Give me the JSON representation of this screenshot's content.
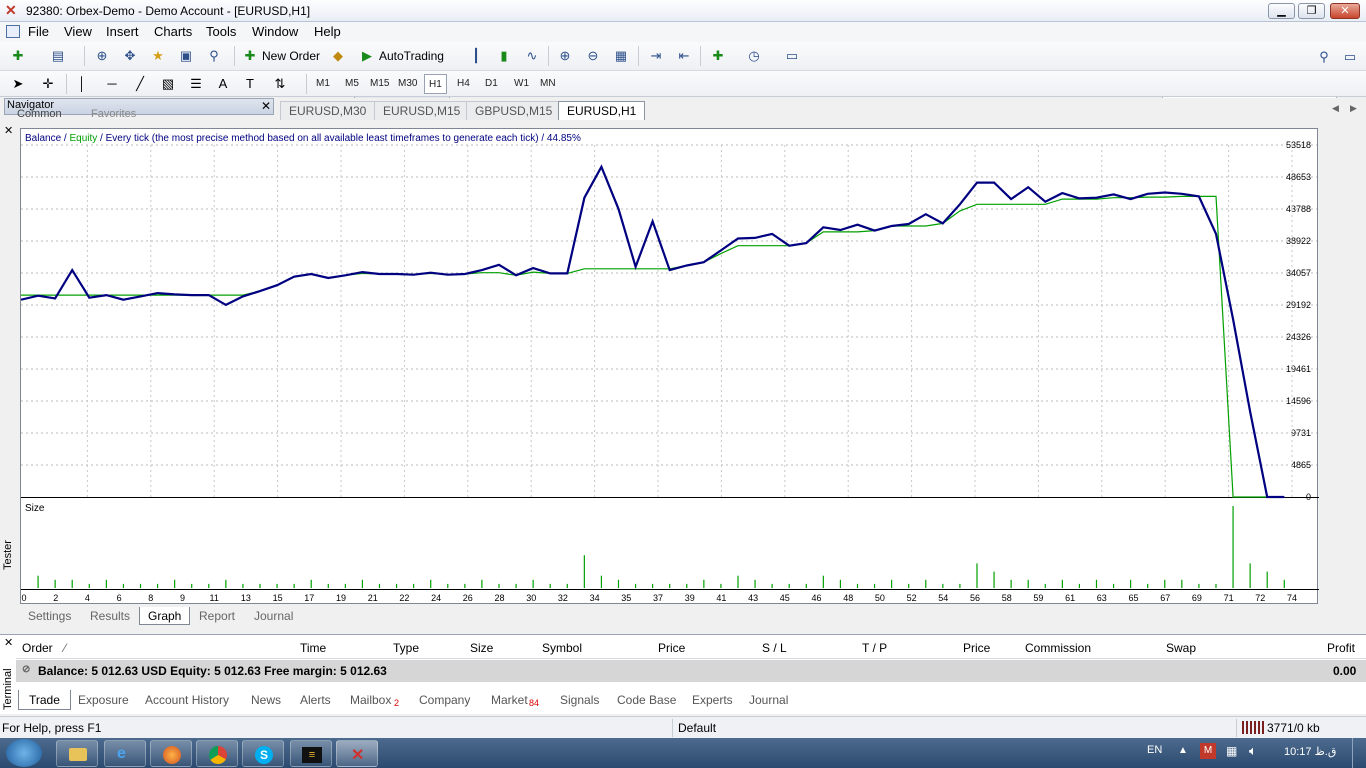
{
  "window": {
    "title": "92380: Orbex-Demo - Demo Account - [EURUSD,H1]"
  },
  "menu": [
    "File",
    "View",
    "Insert",
    "Charts",
    "Tools",
    "Window",
    "Help"
  ],
  "toolbar": {
    "new_order": "New Order",
    "autotrading": "AutoTrading"
  },
  "timeframes": [
    "M1",
    "M5",
    "M15",
    "M30",
    "H1",
    "H4",
    "D1",
    "W1",
    "MN"
  ],
  "active_timeframe": "H1",
  "navigator": {
    "title": "Navigator",
    "tabs": [
      "Common",
      "Favorites"
    ]
  },
  "chart_tabs": [
    "EURUSD,M30",
    "EURUSD,M15",
    "GBPUSD,M15",
    "EURUSD,H1"
  ],
  "active_chart_tab": "EURUSD,H1",
  "tester": {
    "label": "Tester",
    "legend": {
      "balance": "Balance",
      "sep1": " / ",
      "equity": "Equity",
      "rest": " / Every tick (the most precise method based on all available least timeframes to generate each tick) / 44.85%"
    },
    "size_label": "Size",
    "tabs": [
      "Settings",
      "Results",
      "Graph",
      "Report",
      "Journal"
    ],
    "active_tab": "Graph"
  },
  "chart_data": {
    "type": "line",
    "ylim": [
      0,
      53518
    ],
    "y_ticks": [
      "53518",
      "48653",
      "43788",
      "38922",
      "34057",
      "29192",
      "24326",
      "19461",
      "14596",
      "9731",
      "4865",
      "0"
    ],
    "x_ticks": [
      "0",
      "2",
      "4",
      "6",
      "8",
      "9",
      "11",
      "13",
      "15",
      "17",
      "19",
      "21",
      "22",
      "24",
      "26",
      "28",
      "30",
      "32",
      "34",
      "35",
      "37",
      "39",
      "41",
      "43",
      "45",
      "46",
      "48",
      "50",
      "52",
      "54",
      "56",
      "58",
      "59",
      "61",
      "63",
      "65",
      "67",
      "69",
      "71",
      "72",
      "74"
    ],
    "colors": {
      "balance": "#000080",
      "equity": "#00a000",
      "size": "#00a000"
    },
    "series": [
      {
        "name": "Balance",
        "x": [
          0,
          1,
          2,
          3,
          4,
          5,
          6,
          7,
          8,
          9,
          10,
          11,
          12,
          13,
          14,
          15,
          16,
          17,
          18,
          19,
          20,
          21,
          22,
          23,
          24,
          25,
          26,
          27,
          28,
          29,
          30,
          31,
          32,
          33,
          34,
          35,
          36,
          37,
          38,
          39,
          40,
          41,
          42,
          43,
          44,
          45,
          46,
          47,
          48,
          49,
          50,
          51,
          52,
          53,
          54,
          55,
          56,
          57,
          58,
          59,
          60,
          61,
          62,
          63,
          64,
          65,
          66,
          67,
          68,
          69,
          70,
          71,
          72,
          73,
          74
        ],
        "y": [
          30000,
          30600,
          30200,
          34500,
          30300,
          30700,
          30000,
          30500,
          31000,
          30800,
          30700,
          30700,
          29200,
          30500,
          31300,
          32200,
          33500,
          33900,
          33300,
          33700,
          34200,
          33900,
          33900,
          33800,
          34100,
          33800,
          33900,
          34500,
          35300,
          33700,
          34800,
          34000,
          34000,
          45500,
          50200,
          43800,
          35000,
          41900,
          34500,
          35200,
          35700,
          37500,
          39300,
          39400,
          40000,
          38200,
          38600,
          41000,
          40600,
          41400,
          40500,
          41200,
          41500,
          43000,
          41600,
          44500,
          47800,
          47800,
          45300,
          47100,
          44900,
          46200,
          45400,
          45500,
          46000,
          45300,
          46100,
          46300,
          46100,
          45700,
          40000,
          27000,
          13000,
          0,
          0
        ]
      },
      {
        "name": "Equity",
        "x": [
          0,
          7,
          13,
          14,
          15,
          16,
          17,
          18,
          19,
          20,
          21,
          22,
          23,
          24,
          25,
          26,
          27,
          28,
          29,
          30,
          31,
          32,
          33,
          34,
          35,
          36,
          37,
          38,
          39,
          40,
          41,
          42,
          43,
          44,
          45,
          46,
          47,
          48,
          49,
          50,
          51,
          52,
          53,
          54,
          55,
          56,
          57,
          58,
          59,
          60,
          61,
          62,
          63,
          64,
          65,
          66,
          67,
          68,
          69,
          70,
          71,
          72,
          73,
          74
        ],
        "y": [
          30700,
          30700,
          30700,
          31300,
          32200,
          33500,
          33900,
          33300,
          33700,
          34000,
          33900,
          33900,
          33800,
          34000,
          33800,
          33900,
          34100,
          34100,
          33700,
          34200,
          34000,
          34000,
          34700,
          34700,
          34700,
          34700,
          34700,
          34700,
          35200,
          35700,
          37000,
          38200,
          38200,
          38200,
          38200,
          38600,
          40300,
          40300,
          40300,
          40500,
          41200,
          41200,
          41200,
          41600,
          43500,
          44500,
          44500,
          44500,
          44500,
          44500,
          45300,
          45300,
          45300,
          45500,
          45500,
          45600,
          45600,
          45700,
          45700,
          45700,
          0,
          0,
          0,
          0
        ]
      },
      {
        "name": "Size",
        "x": [
          1,
          2,
          3,
          4,
          5,
          6,
          7,
          8,
          9,
          10,
          11,
          12,
          13,
          14,
          15,
          16,
          17,
          18,
          19,
          20,
          21,
          22,
          23,
          24,
          25,
          26,
          27,
          28,
          29,
          30,
          31,
          32,
          33,
          34,
          35,
          36,
          37,
          38,
          39,
          40,
          41,
          42,
          43,
          44,
          45,
          46,
          47,
          48,
          49,
          50,
          51,
          52,
          53,
          54,
          55,
          56,
          57,
          58,
          59,
          60,
          61,
          62,
          63,
          64,
          65,
          66,
          67,
          68,
          69,
          70,
          71,
          72,
          73,
          74
        ],
        "y": [
          3,
          2,
          2,
          1,
          2,
          1,
          1,
          1,
          2,
          1,
          1,
          2,
          1,
          1,
          1,
          1,
          2,
          1,
          1,
          2,
          1,
          1,
          1,
          2,
          1,
          1,
          2,
          1,
          1,
          2,
          1,
          1,
          8,
          3,
          2,
          1,
          1,
          1,
          1,
          2,
          1,
          3,
          2,
          1,
          1,
          1,
          3,
          2,
          1,
          1,
          2,
          1,
          2,
          1,
          1,
          6,
          4,
          2,
          2,
          1,
          2,
          1,
          2,
          1,
          2,
          1,
          2,
          2,
          1,
          1,
          20,
          6,
          4,
          2
        ]
      }
    ]
  },
  "terminal": {
    "label": "Terminal",
    "columns": [
      "Order",
      "Time",
      "Type",
      "Size",
      "Symbol",
      "Price",
      "S / L",
      "T / P",
      "Price",
      "Commission",
      "Swap",
      "Profit"
    ],
    "balance_line": "Balance: 5 012.63 USD  Equity: 5 012.63  Free margin: 5 012.63",
    "profit": "0.00",
    "tabs": [
      {
        "label": "Trade"
      },
      {
        "label": "Exposure"
      },
      {
        "label": "Account History"
      },
      {
        "label": "News"
      },
      {
        "label": "Alerts"
      },
      {
        "label": "Mailbox",
        "badge": "2"
      },
      {
        "label": "Company"
      },
      {
        "label": "Market",
        "badge": "84"
      },
      {
        "label": "Signals"
      },
      {
        "label": "Code Base"
      },
      {
        "label": "Experts"
      },
      {
        "label": "Journal"
      }
    ],
    "active_tab": "Trade"
  },
  "statusbar": {
    "help": "For Help, press F1",
    "profile": "Default",
    "traffic": "3771/0 kb"
  },
  "taskbar": {
    "lang": "EN",
    "time": "10:17 ق.ظ"
  }
}
